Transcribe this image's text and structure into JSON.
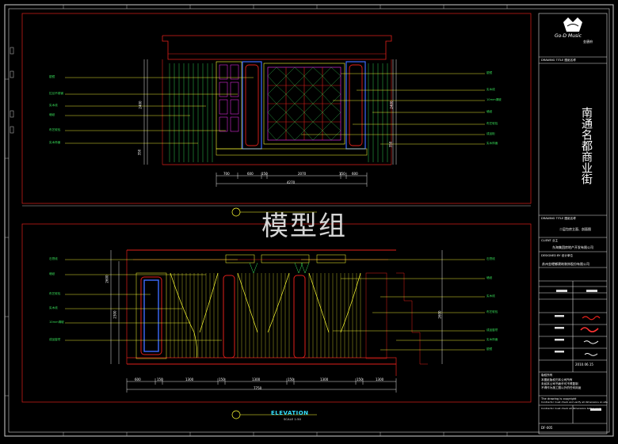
{
  "watermark": "模型组",
  "title_block": {
    "logo_text": "Go‑D Music",
    "logo_sub": "金唐府",
    "project_name": "南通名都商业街",
    "drawing_title_label": "DRAWING TITLE 图纸名称",
    "drawing_title": "二层包房立面、剖面图",
    "client_label": "CLIENT 业主",
    "client": "东海集团房地产开发有限公司",
    "designer_label": "DESIGNED BY 设计单位",
    "designer": "苏州金螳螂建筑装饰股份有限公司",
    "date": "2010.06.15",
    "copyright_label": "版权所有",
    "notes": [
      "本图纸版权归本公司所有",
      "未经本公司书面许可不得复制",
      "不得作为施工图以外的任何用途",
      "The drawing is copyright",
      "Contractor must check and verify all dimensions on site",
      "Contractor must check all dimensions before work"
    ],
    "drawing_no": "DF-005"
  },
  "upper_elevation": {
    "dims_bottom": [
      "700",
      "600",
      "150",
      "2070",
      "150",
      "600"
    ],
    "total": "4270",
    "left_labels": [
      "银镜",
      "拉丝不锈钢",
      "实木线",
      "墙纸",
      "布艺软包",
      "实木饰面"
    ],
    "right_labels": [
      "银镜",
      "实木线",
      "10mm清玻",
      "墙纸",
      "布艺软包",
      "成品柜",
      "实木饰面"
    ],
    "dims_left": [
      "2400",
      "350"
    ],
    "dims_right": [
      "2400",
      "350"
    ]
  },
  "lower_elevation": {
    "dims_bottom": [
      "600",
      "150",
      "1300",
      "150",
      "1300",
      "150",
      "1300",
      "150",
      "1300"
    ],
    "total": "7750",
    "left_labels": [
      "石膏线",
      "墙纸",
      "布艺软包",
      "实木线",
      "10mm清玻",
      "成品窗帘"
    ],
    "right_labels": [
      "石膏线",
      "墙纸",
      "实木线",
      "布艺软包",
      "成品窗帘",
      "实木饰面",
      "银镜"
    ],
    "dims_left": [
      "2600",
      "2300"
    ],
    "dims_right": [
      "2600"
    ]
  },
  "footer": {
    "elevation_label": "ELEVATION",
    "scale_label": "SCALE 1:50"
  },
  "colors": {
    "frame": "#dddddd",
    "border_red": "#e0201a",
    "grid_yellow": "#ffff33",
    "green": "#39e05a",
    "magenta": "#ff33ff",
    "cyan": "#33e0ff",
    "blue": "#3d6bff"
  }
}
